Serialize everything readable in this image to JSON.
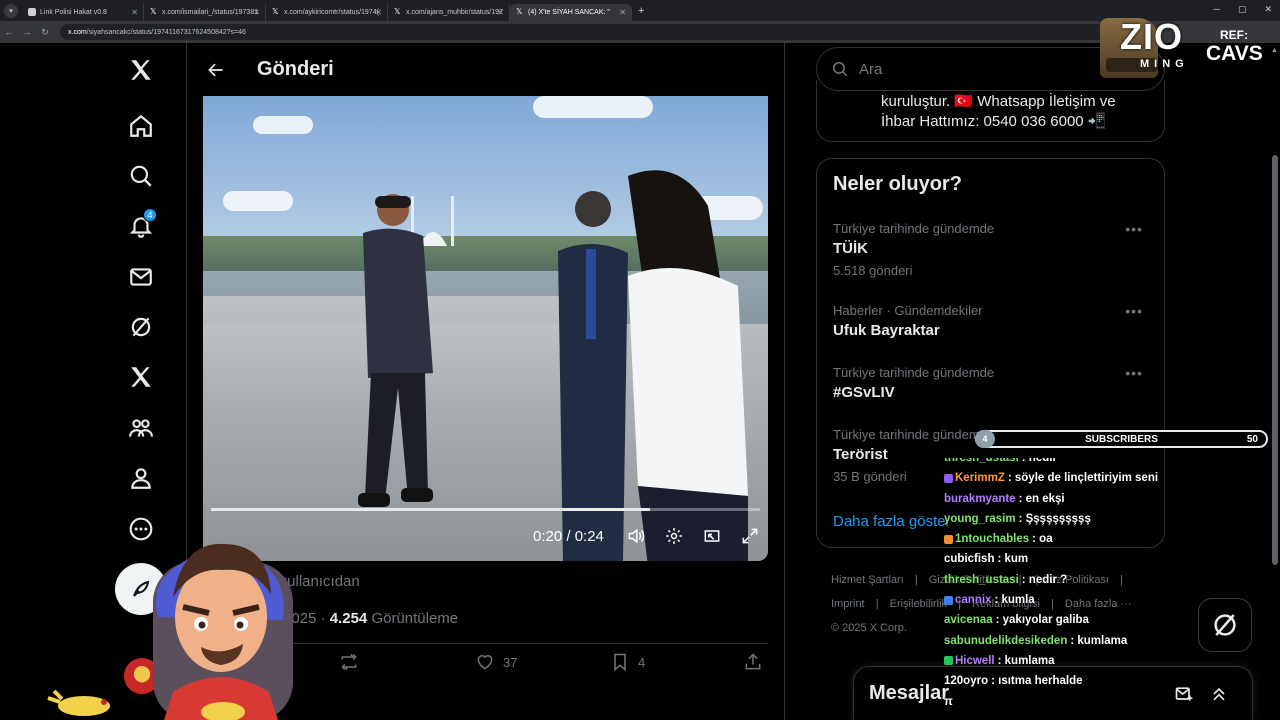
{
  "browser": {
    "tabs": [
      {
        "title": "Link Polisi Hakat v0.8",
        "active": false
      },
      {
        "title": "x.com/ismailari_/status/197381",
        "active": false
      },
      {
        "title": "x.com/aykiricomtr/status/1974(",
        "active": false
      },
      {
        "title": "x.com/ajans_muhbir/status/197",
        "active": false
      },
      {
        "title": "(4) X'te SİYAH SANCAK: \"",
        "active": true
      }
    ],
    "url_domain": "x.com",
    "url_path": "/siyahsancakc/status/1974116731762450842?s=46"
  },
  "nav": {
    "notifications_badge": "4"
  },
  "header": {
    "title": "Gönderi"
  },
  "video": {
    "time": "0:20 / 0:24",
    "progress": 0.8
  },
  "post": {
    "meta1": "lı kullanıcıdan",
    "meta2_date": "ki 2025",
    "views_count": "4.254",
    "views_label": "Görüntüleme",
    "likes": "37",
    "bookmarks": "4"
  },
  "search": {
    "placeholder": "Ara"
  },
  "card1": {
    "line1": "kuruluştur. 🇹🇷 Whatsapp İletişim ve",
    "line2": "İhbar Hattımız: 0540 036 6000 📲"
  },
  "trends": {
    "title": "Neler oluyor?",
    "items": [
      {
        "context": "Türkiye tarihinde gündemde",
        "name": "TÜİK",
        "count": "5.518 gönderi"
      },
      {
        "context": "Haberler · Gündemdekiler",
        "name": "Ufuk Bayraktar",
        "count": ""
      },
      {
        "context": "Türkiye tarihinde gündemde",
        "name": "#GSvLIV",
        "count": ""
      },
      {
        "context": "Türkiye tarihinde gündemde",
        "name": "Terörist",
        "count": "35 B gönderi"
      }
    ],
    "more_glyph": "•••",
    "show_more": "Daha fazla göster"
  },
  "footer": {
    "line1": [
      "Hizmet Şartları",
      "|",
      "Gizlilik Politikası",
      "|",
      "Çerez Politikası",
      "|"
    ],
    "line2": [
      "Imprint",
      "|",
      "Erişilebilirlik",
      "|",
      "Reklam bilgisi",
      "|",
      "Daha fazla ···"
    ],
    "copyright": "© 2025 X Corp."
  },
  "messages": {
    "title": "Mesajlar"
  },
  "overlay": {
    "subs_current": "4",
    "subs_label": "SUBSCRIBERS",
    "subs_goal": "50",
    "logo_text": "ZIO",
    "logo_sub": "MING",
    "ref_label": "REF:",
    "ref_name": "CAVS",
    "chat": [
      {
        "user": "thresh_ustasi",
        "msg": ": nedir",
        "color": "#7ee36b"
      },
      {
        "user": "KerimmZ",
        "msg": ": söyle de linçlettiriyim seni",
        "color": "#ff9a3c"
      },
      {
        "user": "burakmyante",
        "msg": ": en ekşi",
        "color": "#b57bff"
      },
      {
        "user": "young_rasim",
        "msg": ": Şşşşşşşşşş",
        "color": "#7ee36b"
      },
      {
        "user": "1ntouchables",
        "msg": ": oa",
        "color": "#7ee36b"
      },
      {
        "user": "cubicfish",
        "msg": ": kum",
        "color": "#ffffff"
      },
      {
        "user": "thresh_ustasi",
        "msg": ": nedir ?",
        "color": "#7ee36b"
      },
      {
        "user": "cannix",
        "msg": ": kumla",
        "color": "#b57bff"
      },
      {
        "user": "avicenaa",
        "msg": ": yakıyolar galiba",
        "color": "#7ee36b"
      },
      {
        "user": "sabunudelikdesikeden",
        "msg": ": kumlama",
        "color": "#7ee36b"
      },
      {
        "user": "Hicwell",
        "msg": ": kumlama",
        "color": "#b57bff"
      },
      {
        "user": "120oyro",
        "msg": ": ısıtma herhalde",
        "color": "#ffffff"
      },
      {
        "user": "π",
        "msg": "",
        "color": "#ffffff"
      }
    ]
  }
}
